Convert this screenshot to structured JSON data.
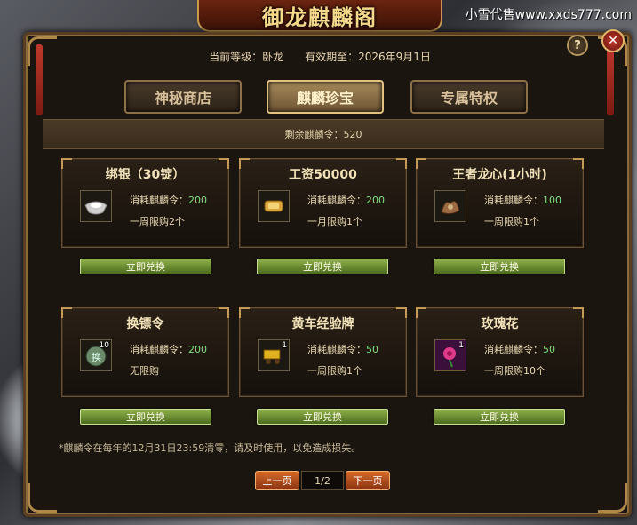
{
  "window": {
    "title": "御龙麒麟阁",
    "watermark": "小雪代售www.xxds777.com",
    "help_label": "?",
    "close_label": "✕"
  },
  "status": {
    "level_label": "当前等级：卧龙",
    "expiry_label": "有效期至：2026年9月1日"
  },
  "tabs": [
    {
      "label": "神秘商店",
      "active": false
    },
    {
      "label": "麒麟珍宝",
      "active": true
    },
    {
      "label": "专属特权",
      "active": false
    }
  ],
  "tokens": {
    "remaining_label": "剩余麒麟令：520"
  },
  "cost_prefix": "消耗麒麟令：",
  "redeem_label": "立即兑换",
  "items": [
    {
      "title": "绑银（30锭）",
      "cost": "200",
      "limit": "一周限购2个",
      "icon": "silver-ingot-icon",
      "qty": ""
    },
    {
      "title": "工资50000",
      "cost": "200",
      "limit": "一月限购1个",
      "icon": "gold-scroll-icon",
      "qty": ""
    },
    {
      "title": "王者龙心(1小时)",
      "cost": "100",
      "limit": "一周限购1个",
      "icon": "dragon-heart-icon",
      "qty": ""
    },
    {
      "title": "换镖令",
      "cost": "200",
      "limit": "无限购",
      "icon": "escort-token-icon",
      "qty": "10"
    },
    {
      "title": "黄车经验牌",
      "cost": "50",
      "limit": "一周限购1个",
      "icon": "yellow-cart-plate-icon",
      "qty": "1"
    },
    {
      "title": "玫瑰花",
      "cost": "50",
      "limit": "一周限购10个",
      "icon": "rose-icon",
      "qty": "1"
    }
  ],
  "footer": {
    "note": "*麒麟令在每年的12月31日23:59清零，请及时使用，以免造成损失。",
    "prev_label": "上一页",
    "page_indicator": "1/2",
    "next_label": "下一页"
  }
}
